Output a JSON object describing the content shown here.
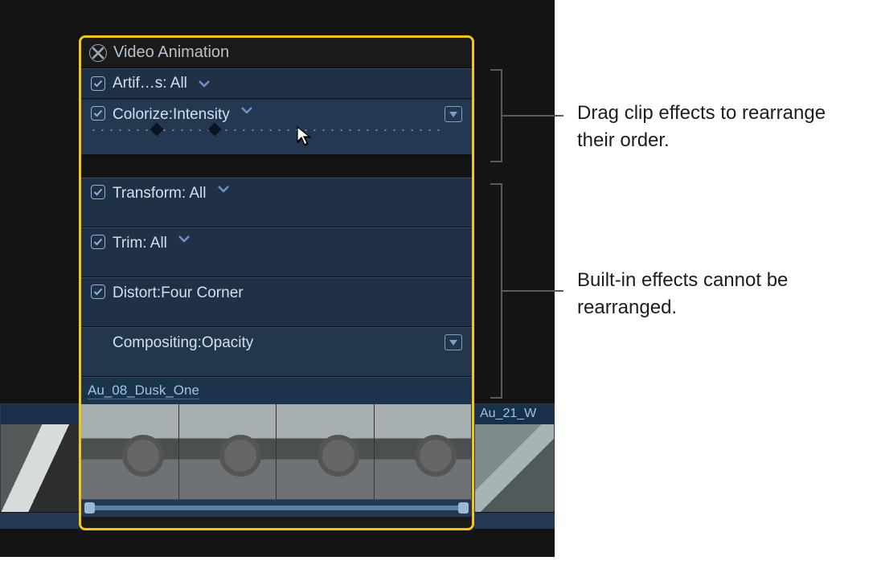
{
  "panel": {
    "title": "Video Animation",
    "rows": {
      "artifacts": {
        "label": "Artif…s: All"
      },
      "colorize": {
        "label": "Colorize:Intensity"
      },
      "transform": {
        "label": "Transform: All"
      },
      "trim": {
        "label": "Trim: All"
      },
      "distort": {
        "label": "Distort:Four Corner"
      },
      "compositing": {
        "label": "Compositing:Opacity"
      }
    },
    "clip_name": "Au_08_Dusk_One"
  },
  "neighbor_clip": "Au_21_W",
  "annotations": {
    "drag": "Drag clip effects to rearrange their order.",
    "builtin": "Built-in effects cannot be rearranged."
  },
  "colors": {
    "highlight_border": "#f5c518",
    "row_bg": "#203046",
    "row_text": "#cfe0ef"
  }
}
